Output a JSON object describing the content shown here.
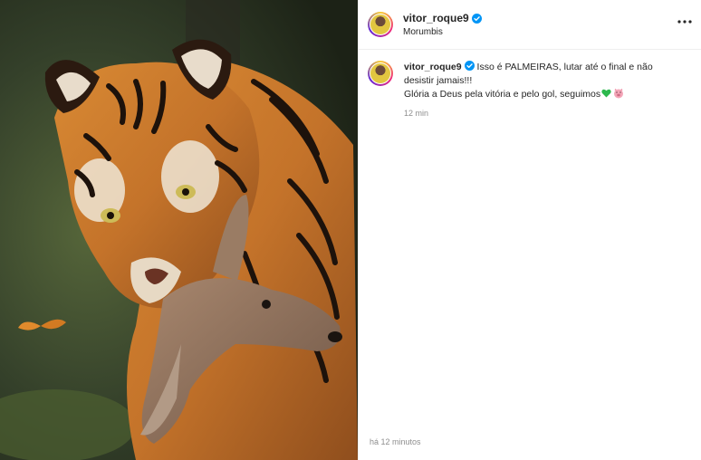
{
  "post": {
    "username": "vitor_roque9",
    "location": "Morumbis",
    "caption_line1": "Isso é PALMEIRAS, lutar até o final e não desistir jamais!!!",
    "caption_line2": "Glória a Deus pela vitória e pelo gol, seguimos",
    "comment_time": "12 min",
    "footer_time": "há 12 minutos"
  },
  "icons": {
    "verified": "verified-badge-icon",
    "more": "more-options-icon",
    "heart": "green-heart-emoji",
    "pig": "pig-face-emoji"
  },
  "colors": {
    "verified_blue": "#0095f6",
    "muted_text": "#8e8e8e",
    "green_heart": "#2db84d"
  }
}
